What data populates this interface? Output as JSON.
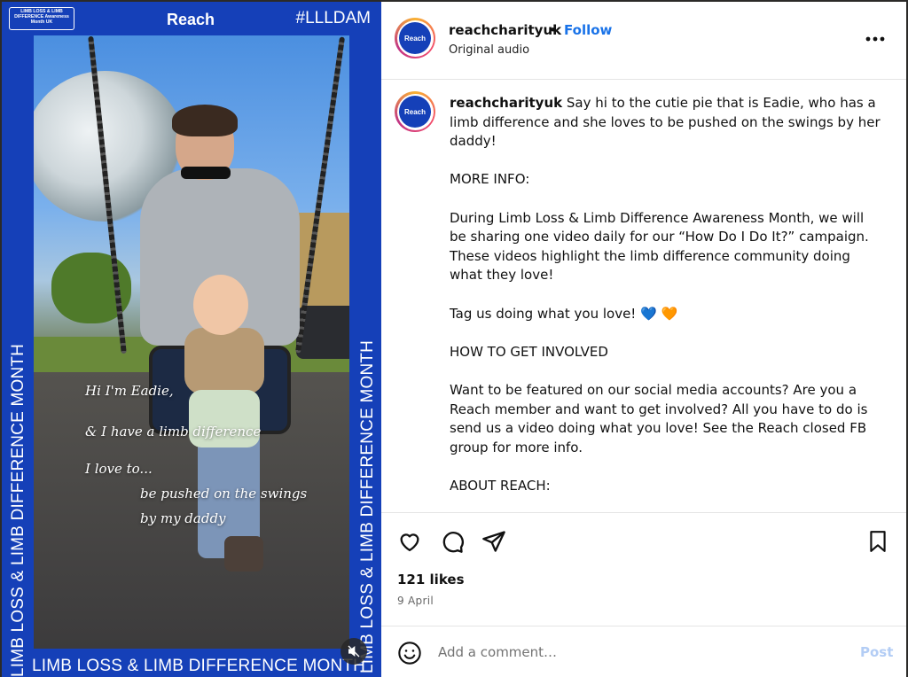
{
  "video": {
    "lldam_logo": "LIMB LOSS & LIMB DIFFERENCE Awareness Month UK",
    "reach_logo": "Reach",
    "hashtag": "#LLLDAM",
    "border_text": "LIMB LOSS & LIMB DIFFERENCE MONTH",
    "overlay": [
      "Hi I'm Eadie,",
      "& I have a limb difference",
      "I love to...",
      "be pushed on the swings",
      "by my daddy"
    ],
    "mute_icon": "muted-speaker-icon"
  },
  "header": {
    "avatar_text": "Reach",
    "username": "reachcharityuk",
    "separator": "•",
    "follow_label": "Follow",
    "audio": "Original audio",
    "more_icon": "more-options-icon"
  },
  "caption": {
    "avatar_text": "Reach",
    "username": "reachcharityuk",
    "intro": "Say hi to the cutie pie that is Eadie, who has a limb difference and she loves to be pushed on the swings by her daddy!",
    "more_info_heading": "MORE INFO:",
    "more_info_body": "During Limb Loss & Limb Difference Awareness Month, we will be sharing one video daily for our “How Do I Do It?” campaign. These videos highlight the limb difference community doing what they love!",
    "tag_line": "Tag us doing what you love!",
    "emoji_blue": "💙",
    "emoji_orange": "🧡",
    "involve_heading": "HOW TO GET INVOLVED",
    "involve_body": "Want to be featured on our social media accounts? Are you a Reach member and want to get involved? All you have to do is send us a video doing what you love! See the Reach closed FB group for more info.",
    "about_heading": "ABOUT REACH:"
  },
  "actions": {
    "like_icon": "heart-icon",
    "comment_icon": "comment-icon",
    "share_icon": "send-icon",
    "save_icon": "bookmark-icon",
    "likes": "121 likes",
    "date": "9 April"
  },
  "comment": {
    "emoji_icon": "smiley-icon",
    "placeholder": "Add a comment…",
    "post_label": "Post"
  },
  "colors": {
    "brand_blue": "#1540b8",
    "follow_blue": "#1a73e8",
    "post_disabled": "#b3cdf5"
  }
}
